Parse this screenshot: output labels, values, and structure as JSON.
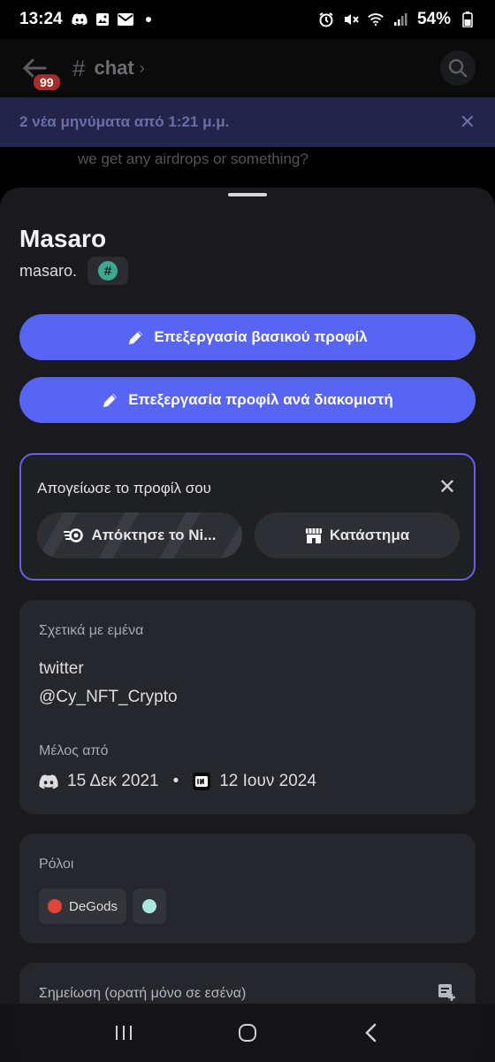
{
  "status_bar": {
    "time": "13:24",
    "battery": "54%",
    "left_icons": [
      "discord-icon",
      "image-icon",
      "mail-icon",
      "dot"
    ],
    "right_icons": [
      "alarm-icon",
      "mute-icon",
      "wifi-icon",
      "signal-icon",
      "battery-icon"
    ]
  },
  "chat_header": {
    "channel": "chat",
    "unread_badge": "99"
  },
  "new_messages_bar": {
    "text": "2 νέα μηνύματα από 1:21 μ.μ."
  },
  "background_message": "we get any airdrops or something?",
  "profile": {
    "display_name": "Masaro",
    "username": "masaro.",
    "badge_symbol": "#"
  },
  "actions": {
    "edit_main": "Επεξεργασία βασικού προφίλ",
    "edit_server": "Επεξεργασία προφίλ ανά διακομιστή"
  },
  "upgrade": {
    "title": "Απογείωσε το προφίλ σου",
    "nitro_label": "Απόκτησε το Νi...",
    "shop_label": "Κατάστημα"
  },
  "about": {
    "label": "Σχετικά με εμένα",
    "line1": "twitter",
    "line2": "@Cy_NFT_Crypto",
    "member_since_label": "Μέλος από",
    "discord_date": "15 Δεκ 2021",
    "separator": "•",
    "server_date": "12 Ιουν 2024"
  },
  "roles": {
    "label": "Ρόλοι",
    "items": [
      {
        "name": "DeGods",
        "color": "#e0463b"
      },
      {
        "name": "",
        "color": "#a8e6df"
      }
    ]
  },
  "note": {
    "label": "Σημείωση (ορατή μόνο σε εσένα)"
  },
  "colors": {
    "blurple": "#5865f2",
    "online": "#3ba55d",
    "sheet_bg": "#1a1a1e",
    "card_bg": "#26272c"
  }
}
